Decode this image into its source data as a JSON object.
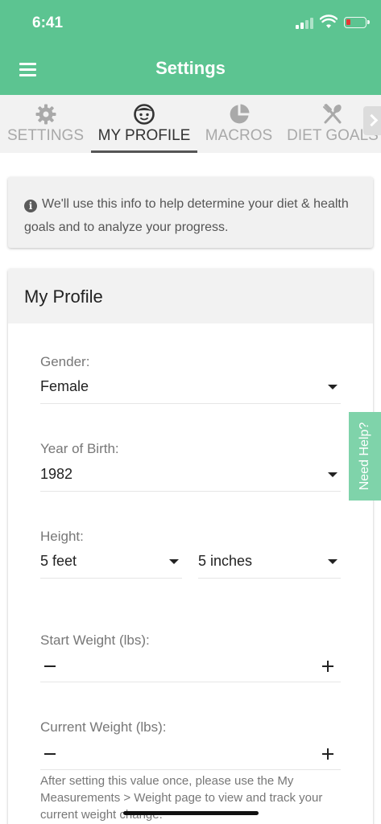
{
  "status_bar": {
    "time": "6:41",
    "battery_color": "#e53935"
  },
  "header": {
    "title": "Settings",
    "menu_icon": "hamburger-icon",
    "color": "#5cc491"
  },
  "tabs": [
    {
      "label": "SETTINGS",
      "icon": "gear-icon",
      "active": false
    },
    {
      "label": "MY PROFILE",
      "icon": "face-icon",
      "active": true
    },
    {
      "label": "MACROS",
      "icon": "pie-chart-icon",
      "active": false
    },
    {
      "label": "DIET GOALS",
      "icon": "utensils-icon",
      "active": false
    }
  ],
  "info": {
    "text": "We'll use this info to help determine your diet & health goals and to analyze your progress."
  },
  "profile": {
    "title": "My Profile",
    "gender": {
      "label": "Gender:",
      "value": "Female"
    },
    "birth_year": {
      "label": "Year of Birth:",
      "value": "1982"
    },
    "height": {
      "label": "Height:",
      "feet": "5 feet",
      "inches": "5 inches"
    },
    "start_weight": {
      "label": "Start Weight (lbs):",
      "value": ""
    },
    "current_weight": {
      "label": "Current Weight (lbs):",
      "value": ""
    },
    "hint": "After setting this value once, please use the My Measurements > Weight page to view and track your current weight change."
  },
  "help": {
    "label": "Need Help?",
    "color": "#7fd3aa"
  }
}
